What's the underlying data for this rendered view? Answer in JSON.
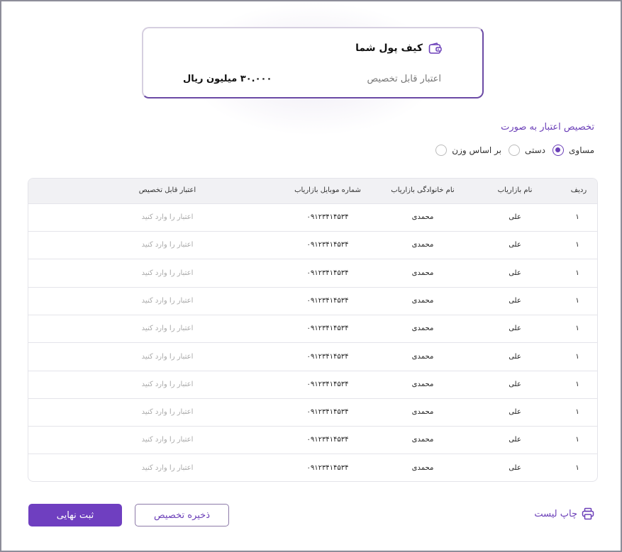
{
  "wallet": {
    "title": "کیف پول شما",
    "credit_label": "اعتبار قابل تخصیص",
    "amount": "۳۰.۰۰۰ میلیون ریال",
    "icon": "wallet-icon"
  },
  "allocation": {
    "title": "تخصیص اعتبار به صورت",
    "options": [
      {
        "label": "مساوی",
        "selected": true
      },
      {
        "label": "دستی",
        "selected": false
      },
      {
        "label": "بر اساس وزن",
        "selected": false
      }
    ]
  },
  "table": {
    "headers": {
      "row": "ردیف",
      "first_name": "نام بازاریاب",
      "last_name": "نام خانوادگی بازاریاب",
      "mobile": "شماره موبایل بازاریاب",
      "credit": "اعتبار قابل تخصیص"
    },
    "rows": [
      {
        "row": "۱",
        "first_name": "علی",
        "last_name": "محمدی",
        "mobile": "۰۹۱۲۳۴۱۴۵۳۴",
        "credit_placeholder": "اعتبار را وارد کنید"
      },
      {
        "row": "۱",
        "first_name": "علی",
        "last_name": "محمدی",
        "mobile": "۰۹۱۲۳۴۱۴۵۳۴",
        "credit_placeholder": "اعتبار را وارد کنید"
      },
      {
        "row": "۱",
        "first_name": "علی",
        "last_name": "محمدی",
        "mobile": "۰۹۱۲۳۴۱۴۵۳۴",
        "credit_placeholder": "اعتبار را وارد کنید"
      },
      {
        "row": "۱",
        "first_name": "علی",
        "last_name": "محمدی",
        "mobile": "۰۹۱۲۳۴۱۴۵۳۴",
        "credit_placeholder": "اعتبار را وارد کنید"
      },
      {
        "row": "۱",
        "first_name": "علی",
        "last_name": "محمدی",
        "mobile": "۰۹۱۲۳۴۱۴۵۳۴",
        "credit_placeholder": "اعتبار را وارد کنید"
      },
      {
        "row": "۱",
        "first_name": "علی",
        "last_name": "محمدی",
        "mobile": "۰۹۱۲۳۴۱۴۵۳۴",
        "credit_placeholder": "اعتبار را وارد کنید"
      },
      {
        "row": "۱",
        "first_name": "علی",
        "last_name": "محمدی",
        "mobile": "۰۹۱۲۳۴۱۴۵۳۴",
        "credit_placeholder": "اعتبار را وارد کنید"
      },
      {
        "row": "۱",
        "first_name": "علی",
        "last_name": "محمدی",
        "mobile": "۰۹۱۲۳۴۱۴۵۳۴",
        "credit_placeholder": "اعتبار را وارد کنید"
      },
      {
        "row": "۱",
        "first_name": "علی",
        "last_name": "محمدی",
        "mobile": "۰۹۱۲۳۴۱۴۵۳۴",
        "credit_placeholder": "اعتبار را وارد کنید"
      },
      {
        "row": "۱",
        "first_name": "علی",
        "last_name": "محمدی",
        "mobile": "۰۹۱۲۳۴۱۴۵۳۴",
        "credit_placeholder": "اعتبار را وارد کنید"
      }
    ]
  },
  "footer": {
    "final_button": "ثبت نهایی",
    "save_button": "ذخیره تخصیص",
    "print_label": "چاپ لیست",
    "print_icon": "printer-icon"
  },
  "colors": {
    "accent": "#6f3fc0",
    "accent_text": "#6b3fb8",
    "border": "#e4e4ea",
    "header_bg": "#f1f1f4"
  }
}
